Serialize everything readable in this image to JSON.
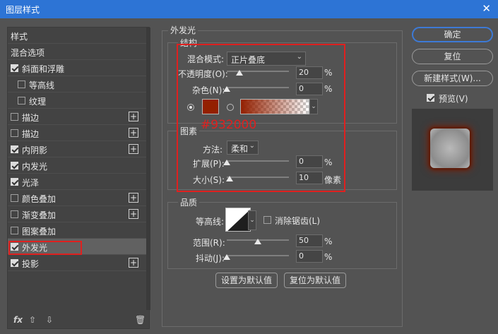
{
  "window": {
    "title": "图层样式",
    "close": "✕"
  },
  "sidebar": {
    "items": [
      {
        "label": "样式",
        "checkbox": false,
        "checked": false,
        "plus": false,
        "selected": false
      },
      {
        "label": "混合选项",
        "checkbox": false,
        "checked": false,
        "plus": false,
        "selected": false
      },
      {
        "label": "斜面和浮雕",
        "checkbox": true,
        "checked": true,
        "plus": false,
        "selected": false
      },
      {
        "label": "等高线",
        "checkbox": true,
        "checked": false,
        "plus": false,
        "selected": false,
        "indent": true
      },
      {
        "label": "纹理",
        "checkbox": true,
        "checked": false,
        "plus": false,
        "selected": false,
        "indent": true
      },
      {
        "label": "描边",
        "checkbox": true,
        "checked": false,
        "plus": true,
        "selected": false
      },
      {
        "label": "描边",
        "checkbox": true,
        "checked": false,
        "plus": true,
        "selected": false
      },
      {
        "label": "内阴影",
        "checkbox": true,
        "checked": true,
        "plus": true,
        "selected": false
      },
      {
        "label": "内发光",
        "checkbox": true,
        "checked": true,
        "plus": false,
        "selected": false
      },
      {
        "label": "光泽",
        "checkbox": true,
        "checked": true,
        "plus": false,
        "selected": false
      },
      {
        "label": "颜色叠加",
        "checkbox": true,
        "checked": false,
        "plus": true,
        "selected": false
      },
      {
        "label": "渐变叠加",
        "checkbox": true,
        "checked": false,
        "plus": true,
        "selected": false
      },
      {
        "label": "图案叠加",
        "checkbox": true,
        "checked": false,
        "plus": false,
        "selected": false
      },
      {
        "label": "外发光",
        "checkbox": true,
        "checked": true,
        "plus": false,
        "selected": true
      },
      {
        "label": "投影",
        "checkbox": true,
        "checked": true,
        "plus": true,
        "selected": false
      }
    ],
    "bottom": {
      "fx": "fx",
      "up": "⇧",
      "down": "⇩",
      "trash": "🗑"
    }
  },
  "panel": {
    "section_title": "外发光",
    "structure": {
      "title": "结构",
      "blend_mode_label": "混合模式:",
      "blend_mode_value": "正片叠底",
      "opacity_label": "不透明度(O):",
      "opacity_value": "20",
      "opacity_unit": "%",
      "opacity_level": 0.2,
      "noise_label": "杂色(N):",
      "noise_value": "0",
      "noise_unit": "%",
      "noise_level": 0.0,
      "glow_color": "#932000",
      "annotation": "#932000"
    },
    "elements": {
      "title": "图素",
      "technique_label": "方法:",
      "technique_value": "柔和",
      "spread_label": "扩展(P):",
      "spread_value": "0",
      "spread_unit": "%",
      "spread_level": 0.0,
      "size_label": "大小(S):",
      "size_value": "10",
      "size_unit": "像素",
      "size_level": 0.05
    },
    "quality": {
      "title": "品质",
      "contour_label": "等高线:",
      "antialias_label": "消除锯齿(L)",
      "antialias_checked": false,
      "range_label": "范围(R):",
      "range_value": "50",
      "range_unit": "%",
      "range_level": 0.5,
      "jitter_label": "抖动(J):",
      "jitter_value": "0",
      "jitter_unit": "%",
      "jitter_level": 0.0
    },
    "set_default": "设置为默认值",
    "reset_default": "复位为默认值"
  },
  "actions": {
    "ok": "确定",
    "reset": "复位",
    "new_style": "新建样式(W)...",
    "preview_label": "预览(V)",
    "preview_checked": true
  },
  "colors": {
    "highlight": "#e0201f",
    "accent": "#2d74d5"
  }
}
